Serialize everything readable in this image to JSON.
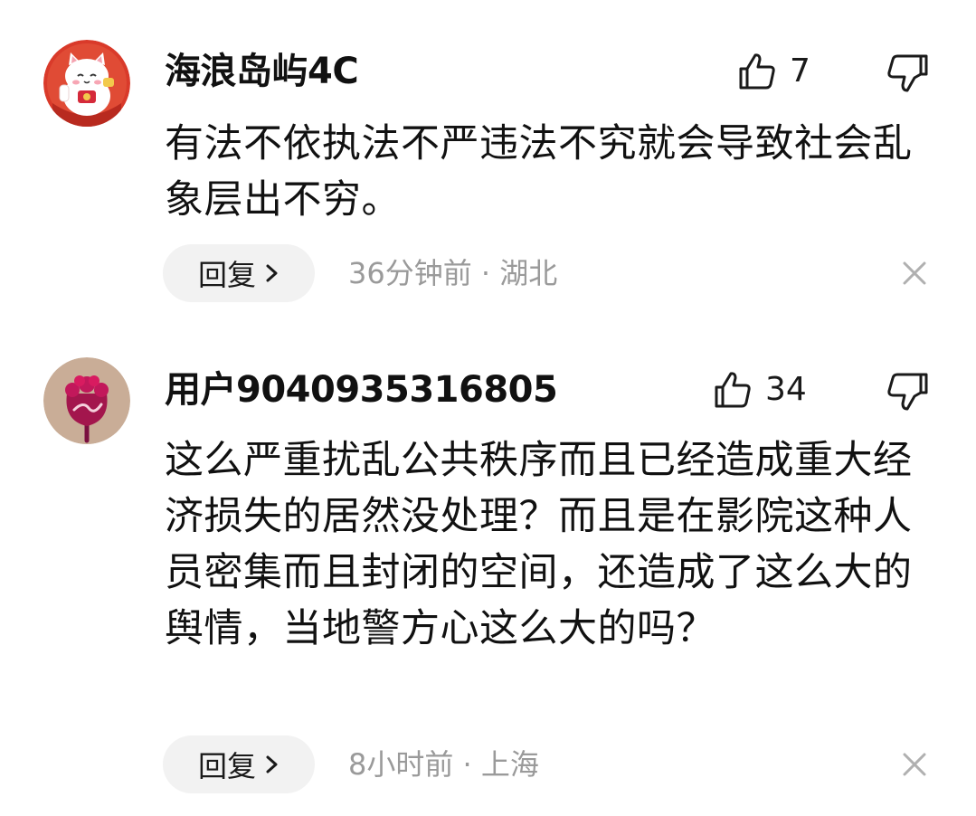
{
  "comments": [
    {
      "username": "海浪岛屿4C",
      "likes": "7",
      "text": "有法不依执法不严违法不究就会导致社会乱象层出不穷。",
      "reply_label": "回复",
      "time_location": "36分钟前 · 湖北",
      "avatar_icon": "lucky-cat-avatar-icon"
    },
    {
      "username": "用户9040935316805",
      "likes": "34",
      "text": "这么严重扰乱公共秩序而且已经造成重大经济损失的居然没处理？而且是在影院这种人员密集而且封闭的空间，还造成了这么大的舆情，当地警方心这么大的吗？",
      "reply_label": "回复",
      "time_location": "8小时前 · 上海",
      "avatar_icon": "flower-avatar-icon"
    }
  ],
  "colors": {
    "meta_text": "#9a9a9a",
    "reply_bg": "#f2f2f2",
    "icon": "#1a1a1a"
  }
}
